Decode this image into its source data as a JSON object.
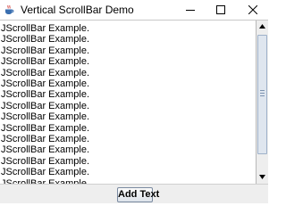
{
  "window": {
    "title": "Vertical ScrollBar Demo",
    "icon": "java-cup-icon"
  },
  "title_controls": {
    "minimize_icon": "minimize-icon",
    "maximize_icon": "maximize-icon",
    "close_icon": "close-icon"
  },
  "text_area": {
    "lines": [
      "JScrollBar Example.",
      "JScrollBar Example.",
      "JScrollBar Example.",
      "JScrollBar Example.",
      "JScrollBar Example.",
      "JScrollBar Example.",
      "JScrollBar Example.",
      "JScrollBar Example.",
      "JScrollBar Example.",
      "JScrollBar Example.",
      "JScrollBar Example.",
      "JScrollBar Example.",
      "JScrollBar Example.",
      "JScrollBar Example.",
      "JScrollBar Example."
    ]
  },
  "scrollbar": {
    "up_icon": "arrow-up-icon",
    "down_icon": "arrow-down-icon",
    "thumb_start": 0.0,
    "thumb_extent": 0.87
  },
  "buttons": {
    "add_text_label": "Add Text"
  }
}
